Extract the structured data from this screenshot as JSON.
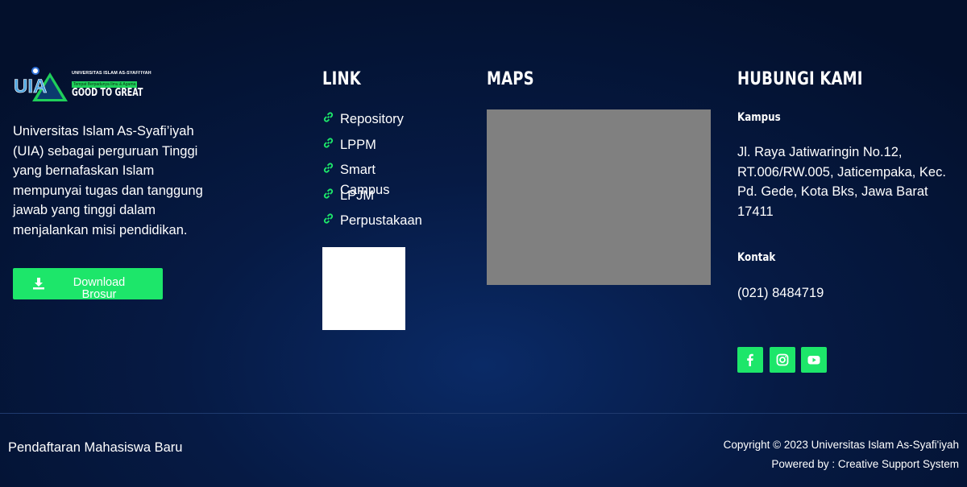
{
  "logo": {
    "letters": "UIA",
    "university_name": "UNIVERSITAS ISLAM AS-SYAFI'IYAH",
    "tagline": "Tempat Berpadunya Ilmu & Agama",
    "slogan": "GOOD TO GREAT",
    "accent_color": "#1fcf5a"
  },
  "about": {
    "text": "Universitas Islam As-Syafi’iyah (UIA) sebagai perguruan Tinggi yang bernafaskan Islam mempunyai tugas dan tanggung jawab yang tinggi dalam menjalankan misi pendidikan."
  },
  "download_button": {
    "label": "Download Brosur",
    "icon": "download-icon",
    "color": "#1de66a"
  },
  "links": {
    "heading": "LINK",
    "items": [
      {
        "label": "Repository",
        "icon": "link-icon"
      },
      {
        "label": "LPPM",
        "icon": "link-icon"
      },
      {
        "label": "Smart Campus",
        "icon": "link-icon"
      },
      {
        "label": "LPJM",
        "icon": "link-icon"
      },
      {
        "label": "Perpustakaan",
        "icon": "link-icon"
      }
    ]
  },
  "maps": {
    "heading": "MAPS"
  },
  "contact": {
    "heading": "HUBUNGI KAMI",
    "campus_label": "Kampus",
    "address": "Jl. Raya Jatiwaringin No.12, RT.006/RW.005, Jaticempaka, Kec. Pd. Gede, Kota Bks, Jawa Barat 17411",
    "contact_label": "Kontak",
    "phone": "(021) 8484719",
    "social": [
      {
        "name": "facebook",
        "icon": "facebook-icon"
      },
      {
        "name": "instagram",
        "icon": "instagram-icon"
      },
      {
        "name": "youtube",
        "icon": "youtube-icon"
      }
    ]
  },
  "bottom_bar": {
    "left_link": "Pendaftaran Mahasiswa Baru",
    "copyright": "Copyright © 2023 Universitas Islam As-Syafi'iyah",
    "powered_by": "Powered by : Creative Support System"
  },
  "colors": {
    "background_dark": "#03102c",
    "background_glow": "#0a2a66",
    "accent_green": "#1de66a",
    "map_placeholder": "#808080"
  }
}
